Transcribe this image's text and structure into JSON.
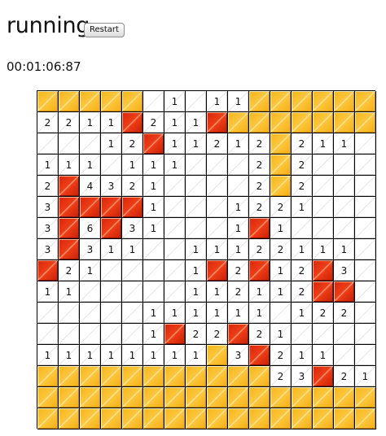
{
  "game": {
    "status": "running",
    "restart_label": "Restart",
    "timer": "00:01:06:87"
  },
  "legend": {
    "hidden_cell": "#f9bd2a",
    "flagged_cell": "#e63412",
    "open_cell": "#ffffff"
  },
  "board": {
    "rows": 16,
    "cols": 16,
    "cells": [
      [
        "H",
        "H",
        "H",
        "H",
        "H",
        "O",
        "1",
        "O",
        "1",
        "1",
        "H",
        "H",
        "H",
        "H",
        "H",
        "H"
      ],
      [
        "2",
        "2",
        "1",
        "1",
        "F",
        "2",
        "1",
        "1",
        "F",
        "H",
        "H",
        "H",
        "H",
        "H",
        "H",
        "H"
      ],
      [
        "O",
        "O",
        "O",
        "1",
        "2",
        "F",
        "1",
        "1",
        "2",
        "1",
        "2",
        "H",
        "2",
        "1",
        "1",
        "O"
      ],
      [
        "1",
        "1",
        "1",
        "O",
        "1",
        "1",
        "1",
        "O",
        "O",
        "O",
        "2",
        "H",
        "2",
        "O",
        "O",
        "O"
      ],
      [
        "2",
        "F",
        "4",
        "3",
        "2",
        "1",
        "O",
        "O",
        "O",
        "O",
        "2",
        "H",
        "2",
        "O",
        "O",
        "O"
      ],
      [
        "3",
        "F",
        "F",
        "F",
        "F",
        "1",
        "O",
        "O",
        "O",
        "1",
        "2",
        "2",
        "1",
        "O",
        "O",
        "O"
      ],
      [
        "3",
        "F",
        "6",
        "F",
        "3",
        "1",
        "O",
        "O",
        "O",
        "1",
        "F",
        "1",
        "O",
        "O",
        "O",
        "O"
      ],
      [
        "3",
        "F",
        "3",
        "1",
        "1",
        "O",
        "O",
        "1",
        "1",
        "1",
        "2",
        "2",
        "1",
        "1",
        "1",
        "O"
      ],
      [
        "F",
        "2",
        "1",
        "O",
        "O",
        "O",
        "O",
        "1",
        "F",
        "2",
        "F",
        "1",
        "2",
        "F",
        "3",
        "O"
      ],
      [
        "1",
        "1",
        "O",
        "O",
        "O",
        "O",
        "O",
        "1",
        "1",
        "2",
        "1",
        "1",
        "2",
        "F",
        "F",
        "O"
      ],
      [
        "O",
        "O",
        "O",
        "O",
        "O",
        "1",
        "1",
        "1",
        "1",
        "1",
        "1",
        "O",
        "1",
        "2",
        "2",
        "O"
      ],
      [
        "O",
        "O",
        "O",
        "O",
        "O",
        "1",
        "F",
        "2",
        "2",
        "F",
        "2",
        "1",
        "O",
        "O",
        "O",
        "O"
      ],
      [
        "1",
        "1",
        "1",
        "1",
        "1",
        "1",
        "1",
        "1",
        "H",
        "3",
        "F",
        "2",
        "1",
        "1",
        "O",
        "O"
      ],
      [
        "H",
        "H",
        "H",
        "H",
        "H",
        "H",
        "H",
        "H",
        "H",
        "H",
        "H",
        "2",
        "3",
        "F",
        "2",
        "1"
      ],
      [
        "H",
        "H",
        "H",
        "H",
        "H",
        "H",
        "H",
        "H",
        "H",
        "H",
        "H",
        "H",
        "H",
        "H",
        "H",
        "H"
      ],
      [
        "H",
        "H",
        "H",
        "H",
        "H",
        "H",
        "H",
        "H",
        "H",
        "H",
        "H",
        "H",
        "H",
        "H",
        "H",
        "H"
      ]
    ]
  }
}
